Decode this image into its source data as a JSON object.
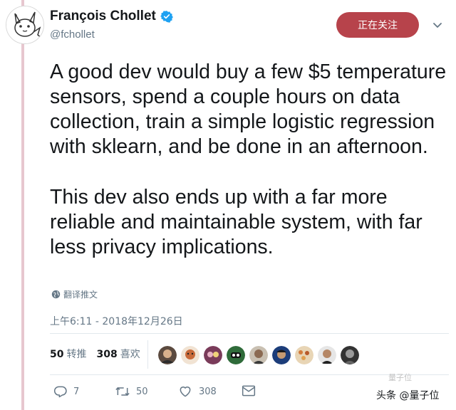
{
  "user": {
    "display_name": "François Chollet",
    "handle": "@fchollet",
    "avatar_icon": "cartoon-pikachu-avatar",
    "verified_icon": "verified-badge-icon",
    "verified_color": "#1da1f2"
  },
  "header": {
    "follow_label": "正在关注",
    "follow_color": "#b7434b",
    "menu_icon": "chevron-down-icon"
  },
  "tweet": {
    "paragraph_1": "A good dev would buy a few $5 temperature sensors, spend a couple hours on data collection, train a simple logistic regression with sklearn, and be done in an afternoon.",
    "paragraph_2": "This dev also ends up with a far more reliable and maintainable system, with far less privacy implications.",
    "translate_label": "翻译推文",
    "translate_icon": "globe-icon",
    "timestamp": "上午6:11 - 2018年12月26日"
  },
  "stats": {
    "retweets_count": "50",
    "retweets_label": "转推",
    "likes_count": "308",
    "likes_label": "喜欢",
    "liker_avatar_count": 9
  },
  "actions": {
    "reply_count": "7",
    "retweet_count": "50",
    "like_count": "308",
    "reply_icon": "reply-icon",
    "retweet_icon": "retweet-icon",
    "like_icon": "heart-icon",
    "message_icon": "envelope-icon"
  },
  "watermark": {
    "text": "头条 @量子位",
    "faint_text": "量子位"
  }
}
